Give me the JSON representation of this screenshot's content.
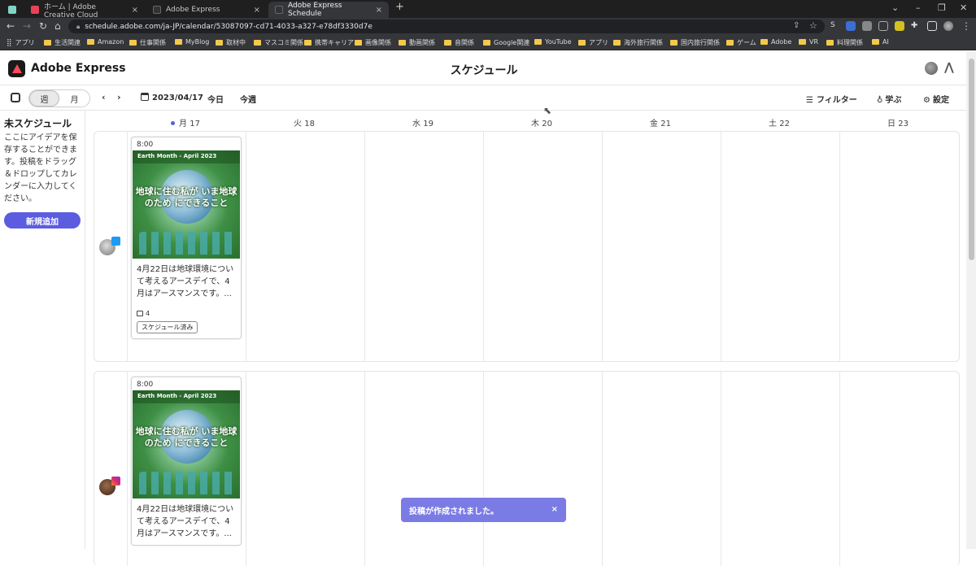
{
  "browser": {
    "tabs": [
      {
        "title": "ホーム | Adobe Creative Cloud",
        "active": false
      },
      {
        "title": "Adobe Express",
        "active": false
      },
      {
        "title": "Adobe Express Schedule",
        "active": true
      }
    ],
    "new_tab": "+",
    "url": "schedule.adobe.com/ja-JP/calendar/53087097-cd71-4033-a327-e78df3330d7e",
    "bookmarks": [
      "アプリ",
      "生活関連",
      "Amazon",
      "仕事関係",
      "MyBlog",
      "取材中",
      "マスコミ関係",
      "携帯キャリア",
      "画像関係",
      "動画関係",
      "音関係",
      "Google関連",
      "YouTube",
      "アプリ",
      "海外旅行関係",
      "国内旅行関係",
      "ゲーム",
      "Adobe",
      "VR",
      "料理関係",
      "AI"
    ]
  },
  "app": {
    "brand": "Adobe Express",
    "page_title": "スケジュール"
  },
  "toolbar": {
    "view_week": "週",
    "view_month": "月",
    "prev": "‹",
    "next": "›",
    "date": "2023/04/17",
    "today": "今日",
    "this_week": "今週",
    "filter": "フィルター",
    "learn": "学ぶ",
    "settings": "設定"
  },
  "sidebar": {
    "title": "未スケジュール",
    "description": "ここにアイデアを保存することができます。投稿をドラッグ＆ドロップしてカレンダーに入力してください。",
    "new_button": "新規追加"
  },
  "calendar": {
    "days": [
      "月 17",
      "火 18",
      "水 19",
      "木 20",
      "金 21",
      "土 22",
      "日 23"
    ],
    "today_index": 0,
    "rows": [
      {
        "platform": "twitter",
        "post": {
          "time": "8:00",
          "image_banner": "Earth Month - April 2023",
          "image_text": "地球に住む私が いま地球のため にできること",
          "text": "4月22日は地球環境について考えるアースデイで、4月はアースマンスです。...",
          "media_count": "4",
          "status": "スケジュール済み"
        }
      },
      {
        "platform": "instagram",
        "post": {
          "time": "8:00",
          "image_banner": "Earth Month - April 2023",
          "image_text": "地球に住む私が いま地球のため にできること",
          "text": "4月22日は地球環境について考えるアースデイで、4月はアースマンスです。..."
        }
      }
    ]
  },
  "toast": {
    "message": "投稿が作成されました。",
    "close": "×"
  },
  "colors": {
    "accent": "#5c5ce0",
    "toast": "#7b7be6",
    "twitter": "#1d9bf0",
    "instagram": "#d62976"
  }
}
